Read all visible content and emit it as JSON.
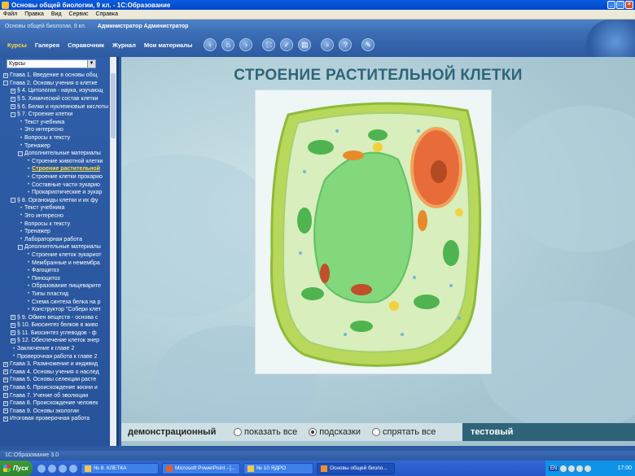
{
  "window": {
    "title": "Основы общей биологии, 9 кл. - 1С:Образование",
    "controls": [
      "_",
      "□",
      "×"
    ]
  },
  "menu": [
    "Файл",
    "Правка",
    "Вид",
    "Сервис",
    "Справка"
  ],
  "header": {
    "course": "Основы общей биологии, 9 кл.",
    "user": "Администратор Администратор"
  },
  "toolbar": {
    "nav": [
      {
        "label": "Курсы",
        "active": true
      },
      {
        "label": "Галерея"
      },
      {
        "label": "Справочник"
      },
      {
        "label": "Журнал"
      },
      {
        "label": "Мои материалы"
      }
    ],
    "icons": [
      "back-icon",
      "home-icon",
      "forward-icon",
      "fullscreen-icon",
      "bookmark-icon",
      "print-icon",
      "search-icon",
      "help-icon",
      "tools-icon"
    ]
  },
  "sidebar": {
    "select_value": "Курсы",
    "tree": [
      {
        "level": 0,
        "marker": "+",
        "text": "Глава 1. Введение в основы общ"
      },
      {
        "level": 0,
        "marker": "-",
        "text": "Глава 2. Основы учения о клетке"
      },
      {
        "level": 1,
        "marker": "+",
        "text": "§ 4. Цитология - наука, изучающ"
      },
      {
        "level": 1,
        "marker": "+",
        "text": "§ 5. Химический состав клетки"
      },
      {
        "level": 1,
        "marker": "+",
        "text": "§ 6. Белки и нуклеиновые кислоты"
      },
      {
        "level": 1,
        "marker": "-",
        "text": "§ 7. Строение клетки"
      },
      {
        "level": 2,
        "marker": "•",
        "text": "Текст учебника"
      },
      {
        "level": 2,
        "marker": "•",
        "text": "Это интересно"
      },
      {
        "level": 2,
        "marker": "•",
        "text": "Вопросы к тексту"
      },
      {
        "level": 2,
        "marker": "•",
        "text": "Тренажер"
      },
      {
        "level": 2,
        "marker": "-",
        "text": "Дополнительные материалы"
      },
      {
        "level": 3,
        "marker": "•",
        "text": "Строение животной клетки"
      },
      {
        "level": 3,
        "marker": "•",
        "text": "Строение растительной",
        "highlight": true
      },
      {
        "level": 3,
        "marker": "•",
        "text": "Строение клетки прокарио"
      },
      {
        "level": 3,
        "marker": "•",
        "text": "Составные части эукарио"
      },
      {
        "level": 3,
        "marker": "•",
        "text": "Прокариотические и эукар"
      },
      {
        "level": 1,
        "marker": "-",
        "text": "§ 8. Органоиды клетки и их фу"
      },
      {
        "level": 2,
        "marker": "•",
        "text": "Текст учебника"
      },
      {
        "level": 2,
        "marker": "•",
        "text": "Это интересно"
      },
      {
        "level": 2,
        "marker": "•",
        "text": "Вопросы к тексту"
      },
      {
        "level": 2,
        "marker": "•",
        "text": "Тренажер"
      },
      {
        "level": 2,
        "marker": "•",
        "text": "Лабораторная работа"
      },
      {
        "level": 2,
        "marker": "-",
        "text": "Дополнительные материалы"
      },
      {
        "level": 3,
        "marker": "•",
        "text": "Строение клеток эукариот"
      },
      {
        "level": 3,
        "marker": "•",
        "text": "Мембранные и немембра"
      },
      {
        "level": 3,
        "marker": "•",
        "text": "Фагоцитоз"
      },
      {
        "level": 3,
        "marker": "•",
        "text": "Пиноцитоз"
      },
      {
        "level": 3,
        "marker": "•",
        "text": "Образование пищеварите"
      },
      {
        "level": 3,
        "marker": "•",
        "text": "Типы пластид"
      },
      {
        "level": 3,
        "marker": "•",
        "text": "Схема синтеза белка на р"
      },
      {
        "level": 3,
        "marker": "•",
        "text": "Конструктор \"Собери клет"
      },
      {
        "level": 1,
        "marker": "+",
        "text": "§ 9. Обмен веществ - основа с"
      },
      {
        "level": 1,
        "marker": "+",
        "text": "§ 10. Биосинтез белков в живо"
      },
      {
        "level": 1,
        "marker": "+",
        "text": "§ 11. Биосинтез углеводов - ф"
      },
      {
        "level": 1,
        "marker": "+",
        "text": "§ 12. Обеспечение клеток энер"
      },
      {
        "level": 1,
        "marker": "•",
        "text": "Заключение к главе 2"
      },
      {
        "level": 1,
        "marker": "•",
        "text": "Проверочная работа к главе 2"
      },
      {
        "level": 0,
        "marker": "+",
        "text": "Глава 3. Размножение и индивид"
      },
      {
        "level": 0,
        "marker": "+",
        "text": "Глава 4. Основы учения о наслед"
      },
      {
        "level": 0,
        "marker": "+",
        "text": "Глава 5. Основы селекции расте"
      },
      {
        "level": 0,
        "marker": "+",
        "text": "Глава 6. Происхождение жизни и"
      },
      {
        "level": 0,
        "marker": "+",
        "text": "Глава 7. Учение об эволюции"
      },
      {
        "level": 0,
        "marker": "+",
        "text": "Глава 8. Происхождение человек"
      },
      {
        "level": 0,
        "marker": "+",
        "text": "Глава 9. Основы экологии"
      },
      {
        "level": 0,
        "marker": "+",
        "text": "Итоговая проверочная работа"
      }
    ]
  },
  "main": {
    "heading": "СТРОЕНИЕ РАСТИТЕЛЬНОЙ КЛЕТКИ",
    "modes": {
      "demo_label": "демонстрационный",
      "options": [
        {
          "label": "показать все",
          "selected": false
        },
        {
          "label": "подсказки",
          "selected": true
        },
        {
          "label": "спрятать все",
          "selected": false
        }
      ],
      "test_label": "тестовый"
    }
  },
  "status": {
    "text": "1С:Образование 3.0"
  },
  "taskbar": {
    "start_label": "Пуск",
    "tasks": [
      {
        "label": "№ 8. КЛЕТКА",
        "active": false
      },
      {
        "label": "Microsoft PowerPoint - [...",
        "active": false
      },
      {
        "label": "№ 10 ЯДРО",
        "active": false
      },
      {
        "label": "Основы общей биоло...",
        "active": true
      }
    ],
    "lang": "EN",
    "clock": "17:00"
  }
}
